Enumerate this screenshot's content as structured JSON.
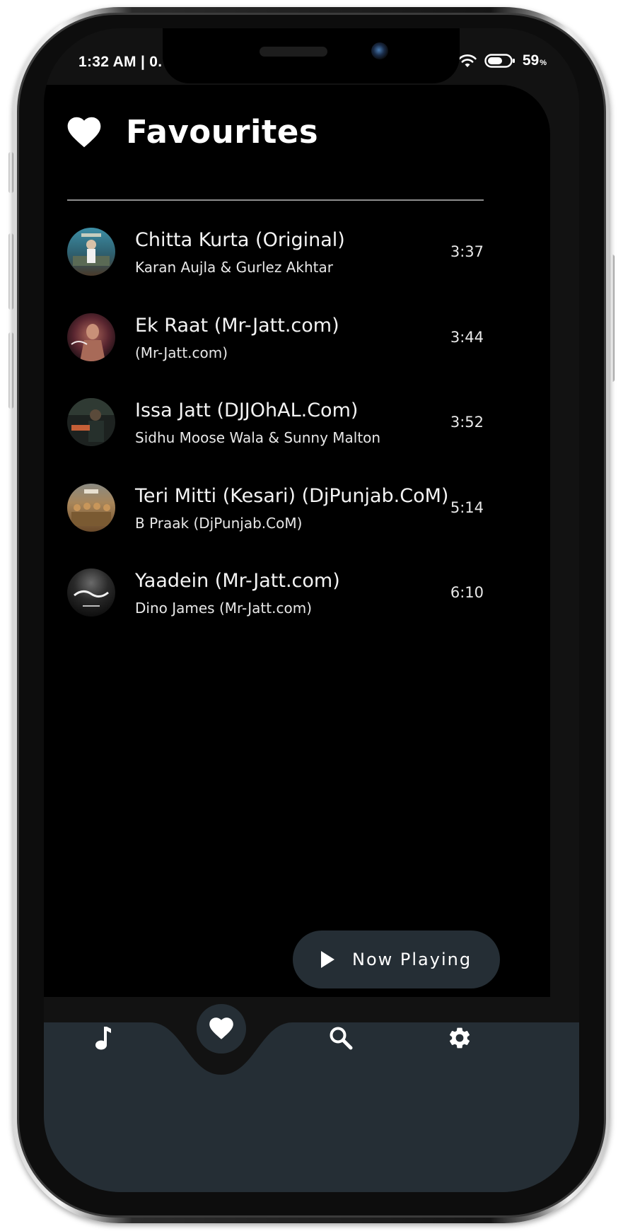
{
  "status_bar": {
    "time": "1:32 AM | 0.",
    "battery_percent": "59",
    "battery_unit": "%",
    "icons": [
      "wifi-icon",
      "battery-icon"
    ]
  },
  "header": {
    "title": "Favourites",
    "icon": "heart-icon"
  },
  "tracks": [
    {
      "title": "Chitta Kurta (Original)",
      "artist": "Karan Aujla & Gurlez Akhtar",
      "duration": "3:37"
    },
    {
      "title": "Ek Raat (Mr-Jatt.com)",
      "artist": "(Mr-Jatt.com)",
      "duration": "3:44"
    },
    {
      "title": "Issa Jatt (DJJOhAL.Com)",
      "artist": "Sidhu Moose Wala & Sunny Malton",
      "duration": "3:52"
    },
    {
      "title": "Teri Mitti (Kesari) (DjPunjab.CoM)",
      "artist": "B Praak (DjPunjab.CoM)",
      "duration": "5:14"
    },
    {
      "title": "Yaadein (Mr-Jatt.com)",
      "artist": "Dino James (Mr-Jatt.com)",
      "duration": "6:10"
    }
  ],
  "now_playing": {
    "label": "Now Playing",
    "icon": "play-icon"
  },
  "bottom_nav": {
    "items": [
      {
        "name": "songs",
        "icon": "music-note-icon"
      },
      {
        "name": "favourites",
        "icon": "heart-icon",
        "active": true
      },
      {
        "name": "search",
        "icon": "search-icon"
      },
      {
        "name": "settings",
        "icon": "gear-icon"
      }
    ]
  },
  "colors": {
    "background": "#000000",
    "surface": "#252e35",
    "text": "#ffffff",
    "divider": "#8d8d8d"
  }
}
